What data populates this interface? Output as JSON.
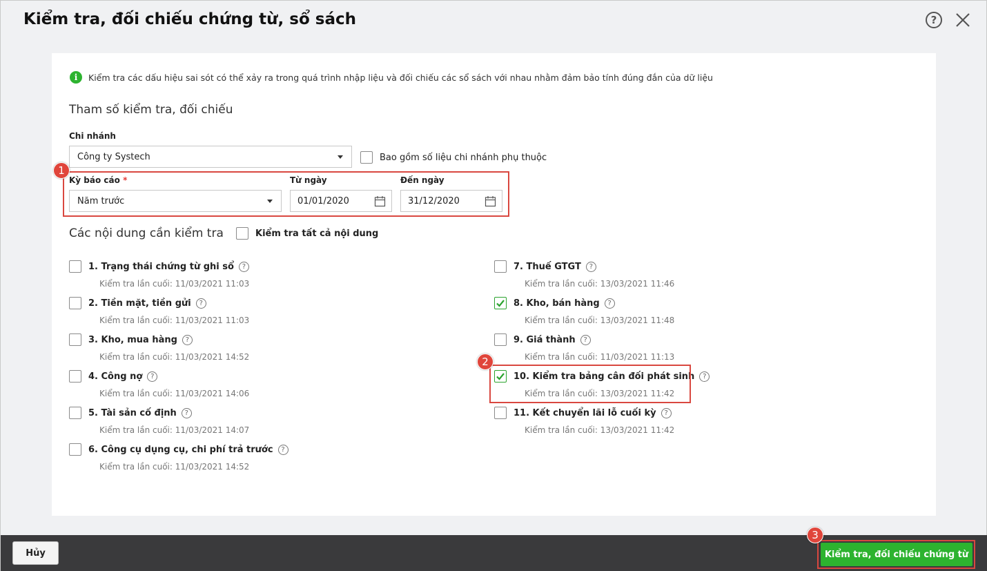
{
  "dialog": {
    "title": "Kiểm tra, đối chiếu chứng từ, sổ sách"
  },
  "info_text": "Kiểm tra các dấu hiệu sai sót có thể xảy ra trong quá trình nhập liệu và đối chiếu các sổ sách với nhau nhằm đảm bảo tính đúng đắn của dữ liệu",
  "params": {
    "section_title": "Tham số kiểm tra, đối chiếu",
    "branch_label": "Chi nhánh",
    "branch_value": "Công ty Systech",
    "include_sub_label": "Bao gồm số liệu chi nhánh phụ thuộc",
    "period_label": "Kỳ báo cáo",
    "required_mark": "*",
    "period_value": "Năm trước",
    "from_label": "Từ ngày",
    "from_value": "01/01/2020",
    "to_label": "Đến ngày",
    "to_value": "31/12/2020"
  },
  "content": {
    "section_title": "Các nội dung cần kiểm tra",
    "check_all_label": "Kiểm tra tất cả nội dung",
    "items": [
      {
        "label": "1. Trạng thái chứng từ ghi sổ",
        "last": "Kiểm tra lần cuối: 11/03/2021 11:03",
        "checked": false
      },
      {
        "label": "2. Tiền mặt, tiền gửi",
        "last": "Kiểm tra lần cuối: 11/03/2021 11:03",
        "checked": false
      },
      {
        "label": "3. Kho, mua hàng",
        "last": "Kiểm tra lần cuối: 11/03/2021 14:52",
        "checked": false
      },
      {
        "label": "4. Công nợ",
        "last": "Kiểm tra lần cuối: 11/03/2021 14:06",
        "checked": false
      },
      {
        "label": "5. Tài sản cố định",
        "last": "Kiểm tra lần cuối: 11/03/2021 14:07",
        "checked": false
      },
      {
        "label": "6. Công cụ dụng cụ, chi phí trả trước",
        "last": "Kiểm tra lần cuối: 11/03/2021 14:52",
        "checked": false
      },
      {
        "label": "7. Thuế GTGT",
        "last": "Kiểm tra lần cuối: 13/03/2021 11:46",
        "checked": false
      },
      {
        "label": "8. Kho, bán hàng",
        "last": "Kiểm tra lần cuối: 13/03/2021 11:48",
        "checked": true
      },
      {
        "label": "9. Giá thành",
        "last": "Kiểm tra lần cuối: 11/03/2021 11:13",
        "checked": false
      },
      {
        "label": "10. Kiểm tra bảng cân đối phát sinh",
        "last": "Kiểm tra lần cuối: 13/03/2021 11:42",
        "checked": true
      },
      {
        "label": "11. Kết chuyển lãi lỗ cuối kỳ",
        "last": "Kiểm tra lần cuối: 13/03/2021 11:42",
        "checked": false
      }
    ]
  },
  "badges": [
    "1",
    "2",
    "3"
  ],
  "footer": {
    "cancel_label": "Hủy",
    "run_label": "Kiểm tra, đối chiếu chứng từ"
  },
  "colors": {
    "accent_green": "#2db32f",
    "annotation_red": "#d9473f"
  }
}
